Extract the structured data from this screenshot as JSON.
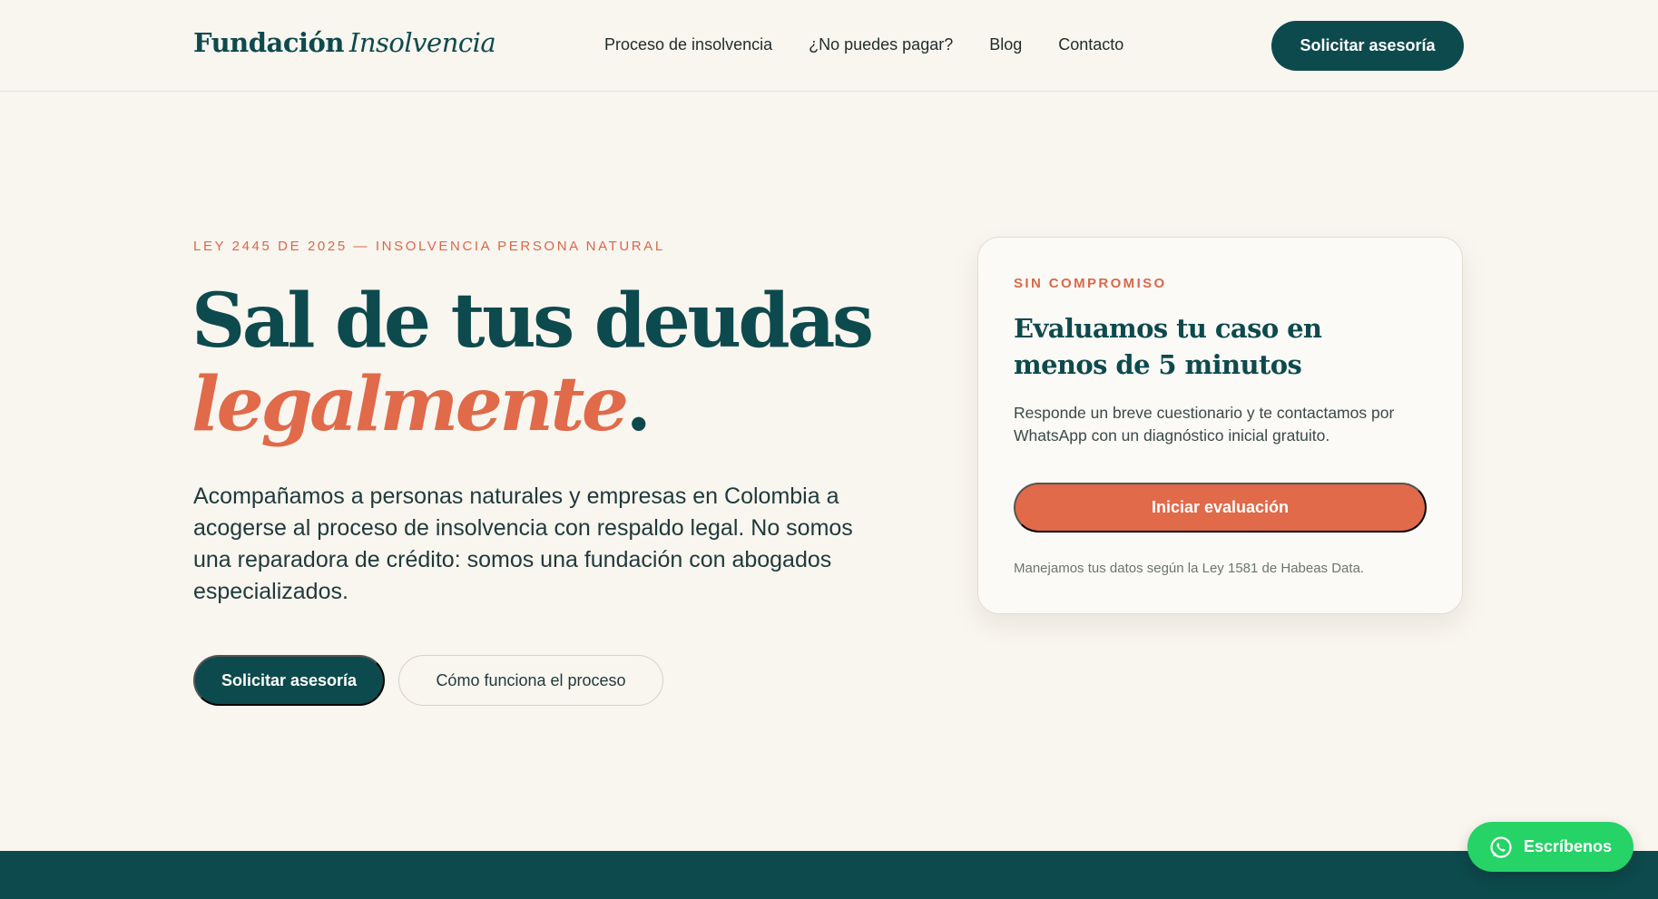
{
  "header": {
    "logo_primary": "Fundación",
    "logo_secondary": "Insolvencia",
    "nav": [
      {
        "label": "Proceso de insolvencia"
      },
      {
        "label": "¿No puedes pagar?"
      },
      {
        "label": "Blog"
      },
      {
        "label": "Contacto"
      }
    ],
    "cta_label": "Solicitar asesoría"
  },
  "hero": {
    "eyebrow": "LEY 2445 DE 2025 — INSOLVENCIA PERSONA NATURAL",
    "headline_line1": "Sal de tus deudas",
    "headline_accent": "legalmente",
    "headline_dot": ".",
    "lead": "Acompañamos a personas naturales y empresas en Colombia a acogerse al proceso de insolvencia con respaldo legal. No somos una reparadora de crédito: somos una fundación con abogados especializados.",
    "primary_button": "Solicitar asesoría",
    "secondary_button": "Cómo funciona el proceso"
  },
  "card": {
    "eyebrow": "SIN COMPROMISO",
    "title": "Evaluamos tu caso en menos de 5 minutos",
    "description": "Responde un breve cuestionario y te contactamos por WhatsApp con un diagnóstico inicial gratuito.",
    "button": "Iniciar evaluación",
    "note": "Manejamos tus datos según la Ley 1581 de Habeas Data."
  },
  "whatsapp": {
    "label": "Escríbenos",
    "icon": "whatsapp-icon"
  },
  "colors": {
    "brand_dark": "#0d4a4d",
    "accent": "#e06a49",
    "background": "#f9f5ef",
    "whatsapp": "#25d366"
  }
}
